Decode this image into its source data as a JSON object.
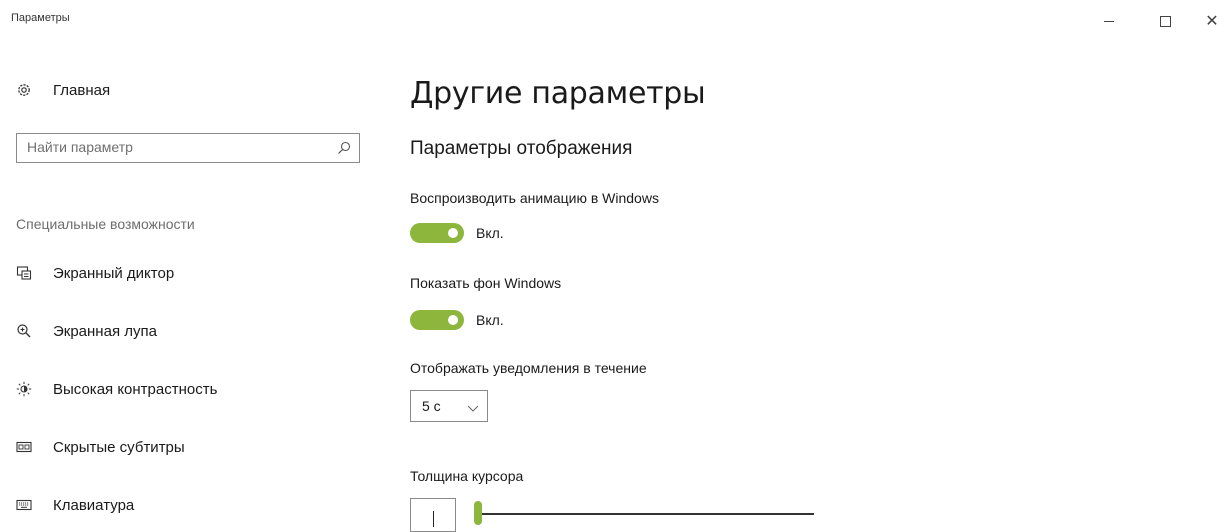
{
  "window": {
    "title": "Параметры",
    "min_glyph": "—",
    "close_glyph": "✕"
  },
  "sidebar": {
    "home_label": "Главная",
    "search_placeholder": "Найти параметр",
    "section_label": "Специальные возможности",
    "items": [
      {
        "label": "Экранный диктор",
        "icon": "narrator-icon"
      },
      {
        "label": "Экранная лупа",
        "icon": "magnifier-icon"
      },
      {
        "label": "Высокая контрастность",
        "icon": "contrast-icon"
      },
      {
        "label": "Скрытые субтитры",
        "icon": "captions-icon"
      },
      {
        "label": "Клавиатура",
        "icon": "keyboard-icon"
      }
    ]
  },
  "main": {
    "title": "Другие параметры",
    "section_title": "Параметры отображения",
    "animations": {
      "label": "Воспроизводить анимацию в Windows",
      "state": "Вкл."
    },
    "background": {
      "label": "Показать фон Windows",
      "state": "Вкл."
    },
    "notifications": {
      "label": "Отображать уведомления в течение",
      "value": "5 с"
    },
    "cursor": {
      "label": "Толщина курсора",
      "value_fraction": 0.0
    }
  },
  "colors": {
    "accent": "#8cb63c"
  }
}
